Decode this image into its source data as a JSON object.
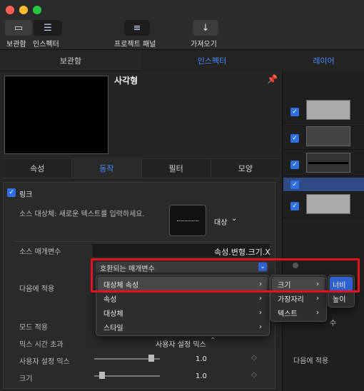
{
  "toolbar": {
    "library_label": "보관함",
    "inspector_label": "인스펙터",
    "project_panel_label": "프로젝트 패널",
    "import_label": "가져오기"
  },
  "tabs": {
    "library": "보관함",
    "inspector": "인스펙터",
    "layers": "레이어"
  },
  "inspector": {
    "title": "사각형",
    "subtabs": [
      "속성",
      "동작",
      "필터",
      "모양"
    ],
    "group_title": "링크",
    "source_object_label": "소스 대상체: 새로운 텍스트를 입력하세요.",
    "target_label": "대상",
    "source_param_label": "소스 매개변수",
    "source_param_value": "속성.변형.크기.X",
    "compatible_params": "호환되는 매개변수",
    "apply_to_label": "다음에 적용",
    "mode_label": "모드 적용",
    "mix_timeout_label": "믹스 시간 초과",
    "mix_timeout_value": "사용자 설정 믹스",
    "custom_mix_label": "사용자 설정 믹스",
    "custom_mix_value": "1.0",
    "custom_mix_level": 0.9,
    "scale_label": "크기",
    "scale_value": "1.0",
    "scale_level": 0.08
  },
  "menu1": [
    "대상체 속성",
    "속성",
    "대상체",
    "스타일"
  ],
  "menu2": [
    "크기",
    "가장자리",
    "텍스트"
  ],
  "menu3": [
    "너비",
    "높이"
  ],
  "layers_panel": {
    "partial_1": "수",
    "apply_to": "다음에 적용"
  },
  "colors": {
    "accent": "#4a8cff",
    "selection": "#2f62d0",
    "callout": "#e0141e"
  }
}
